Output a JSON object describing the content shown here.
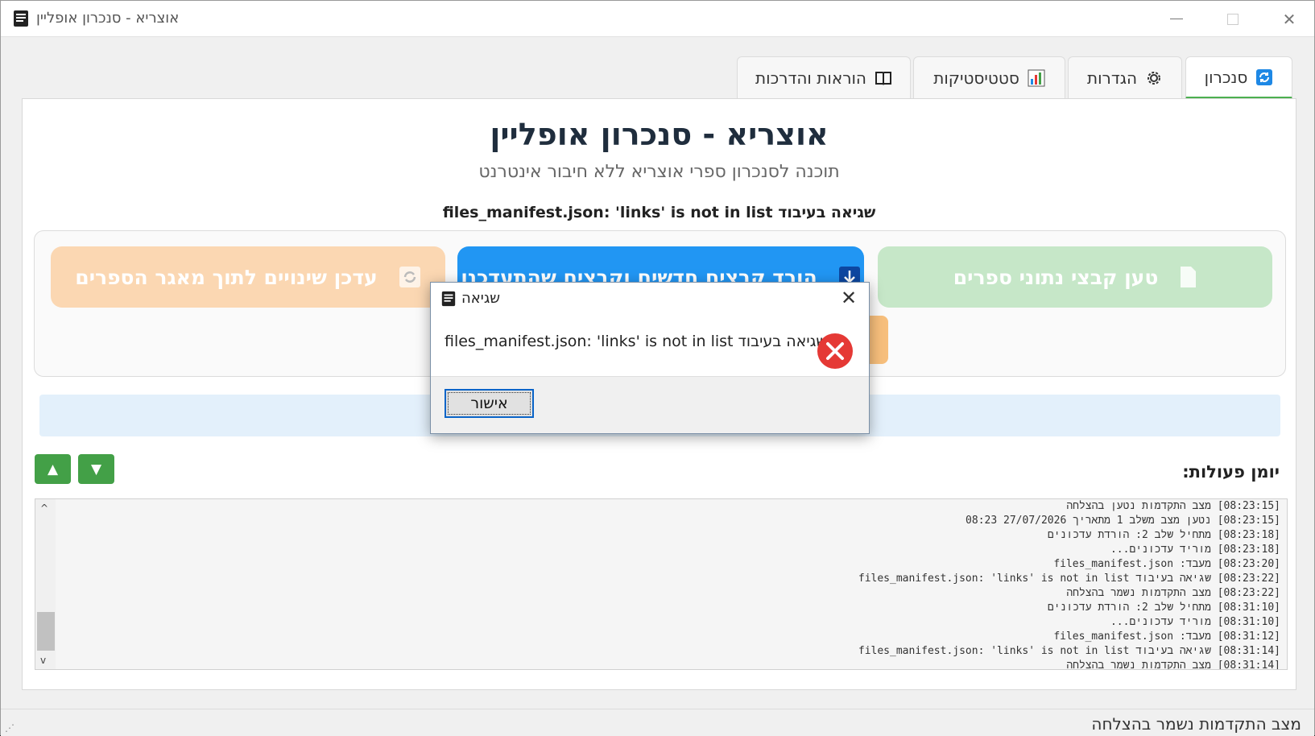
{
  "window": {
    "title": "אוצריא - סנכרון אופליין"
  },
  "tabs": [
    {
      "label": "סנכרון",
      "icon": "sync-icon"
    },
    {
      "label": "הגדרות",
      "icon": "gear-icon"
    },
    {
      "label": "סטטיסטיקות",
      "icon": "bar-chart-icon"
    },
    {
      "label": "הוראות והדרכות",
      "icon": "book-icon"
    }
  ],
  "main": {
    "title": "אוצריא - סנכרון אופליין",
    "subtitle": "תוכנה לסנכרון ספרי אוצריא ללא חיבור אינטרנט",
    "status": "files_manifest.json: 'links' is not in list שגיאה בעיבוד",
    "buttons": {
      "load": "טען קבצי נתוני ספרים",
      "download": "הורד קבצים חדשים וקבצים שהתעדכנו",
      "update": "עדכן שינויים לתוך מאגר הספרים"
    },
    "log_label": "יומן פעולות:",
    "log_lines": [
      "[08:23:15] מצב התקדמות נטען בהצלחה",
      "[08:23:15] נטען מצב משלב 1 מתאריך 27/07/2026 08:23",
      "[08:23:18] מתחיל שלב 2: הורדת עדכונים",
      "[08:23:18] מוריד עדכונים...",
      "[08:23:20] מעבד: files_manifest.json",
      "[08:23:22] שגיאה בעיבוד files_manifest.json: 'links' is not in list",
      "[08:23:22] מצב התקדמות נשמר בהצלחה",
      "[08:31:10] מתחיל שלב 2: הורדת עדכונים",
      "[08:31:10] מוריד עדכונים...",
      "[08:31:12] מעבד: files_manifest.json",
      "[08:31:14] שגיאה בעיבוד files_manifest.json: 'links' is not in list",
      "[08:31:14] מצב התקדמות נשמר בהצלחה"
    ]
  },
  "statusbar": {
    "text": "מצב התקדמות נשמר בהצלחה"
  },
  "dialog": {
    "title": "שגיאה",
    "message": "files_manifest.json: 'links' is not in list שגיאה בעיבוד",
    "ok_label": "אישור"
  },
  "colors": {
    "accent_green": "#4caf50",
    "load_button": "#c6e7c8",
    "download_button": "#2196f3",
    "update_button": "#fbd7b2",
    "error_red": "#e53935"
  }
}
